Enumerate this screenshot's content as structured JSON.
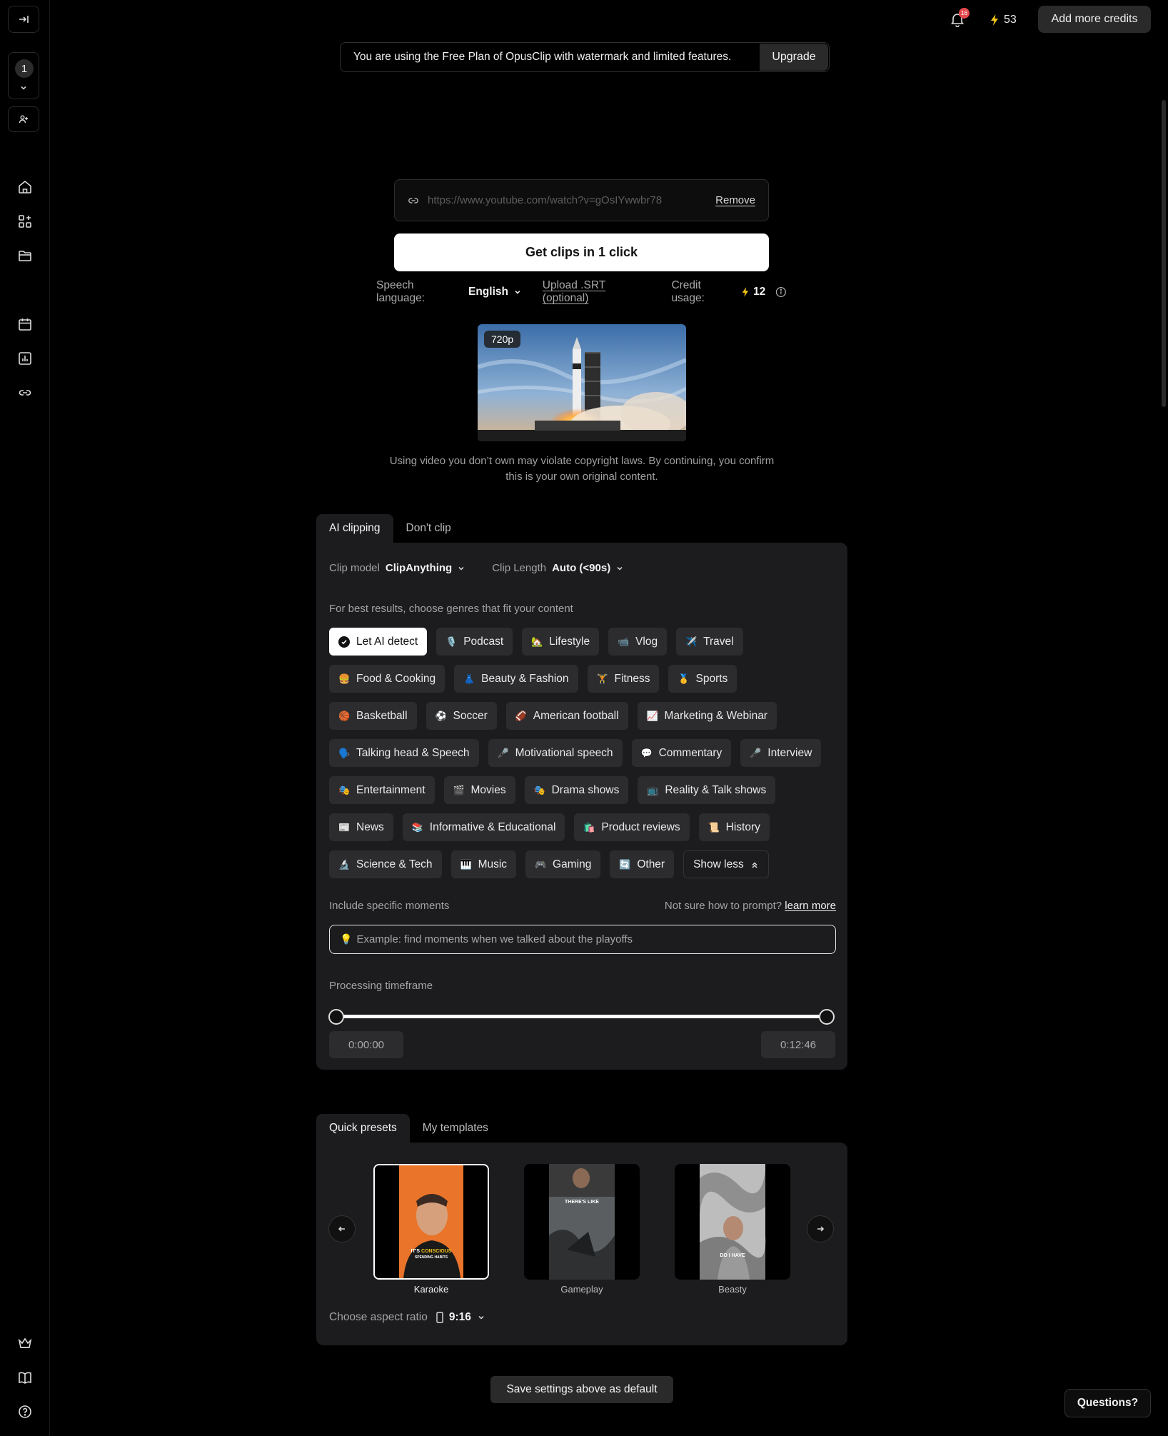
{
  "sidebar": {
    "workspace_number": "1"
  },
  "topbar": {
    "notification_count": "16",
    "credits_count": "53",
    "add_credits_label": "Add more credits"
  },
  "banner": {
    "text": "You are using the Free Plan of OpusClip with watermark and limited features.",
    "upgrade_label": "Upgrade"
  },
  "url_input": {
    "value": "https://www.youtube.com/watch?v=gOsIYwwbr78",
    "remove_label": "Remove"
  },
  "cta_label": "Get clips in 1 click",
  "options": {
    "speech_language_label": "Speech language:",
    "speech_language_value": "English",
    "upload_srt_label": "Upload .SRT (optional)",
    "credit_usage_label": "Credit usage:",
    "credit_usage_value": "12"
  },
  "video": {
    "resolution": "720p"
  },
  "disclaimer": {
    "line1": "Using video you don’t own may violate copyright laws. By continuing, you confirm",
    "line2": "this is your own original content."
  },
  "clipping_tabs": [
    "AI clipping",
    "Don't clip"
  ],
  "clip_settings": {
    "model_label": "Clip model",
    "model_value": "ClipAnything",
    "length_label": "Clip Length",
    "length_value": "Auto (<90s)",
    "genre_hint": "For best results, choose genres that fit your content"
  },
  "genre_rows": [
    [
      {
        "label": "Let AI detect",
        "emoji": "",
        "selected": true
      },
      {
        "label": "Podcast",
        "emoji": "🎙️"
      },
      {
        "label": "Lifestyle",
        "emoji": "🏡"
      },
      {
        "label": "Vlog",
        "emoji": "📹"
      },
      {
        "label": "Travel",
        "emoji": "✈️"
      }
    ],
    [
      {
        "label": "Food & Cooking",
        "emoji": "🍔"
      },
      {
        "label": "Beauty & Fashion",
        "emoji": "👗"
      },
      {
        "label": "Fitness",
        "emoji": "🏋️"
      },
      {
        "label": "Sports",
        "emoji": "🥇"
      }
    ],
    [
      {
        "label": "Basketball",
        "emoji": "🏀"
      },
      {
        "label": "Soccer",
        "emoji": "⚽"
      },
      {
        "label": "American football",
        "emoji": "🏈"
      },
      {
        "label": "Marketing & Webinar",
        "emoji": "📈"
      }
    ],
    [
      {
        "label": "Talking head & Speech",
        "emoji": "🗣️"
      },
      {
        "label": "Motivational speech",
        "emoji": "🎤"
      },
      {
        "label": "Commentary",
        "emoji": "💬"
      },
      {
        "label": "Interview",
        "emoji": "🎤"
      }
    ],
    [
      {
        "label": "Entertainment",
        "emoji": "🎭"
      },
      {
        "label": "Movies",
        "emoji": "🎬"
      },
      {
        "label": "Drama shows",
        "emoji": "🎭"
      },
      {
        "label": "Reality & Talk shows",
        "emoji": "📺"
      }
    ],
    [
      {
        "label": "News",
        "emoji": "📰"
      },
      {
        "label": "Informative & Educational",
        "emoji": "📚"
      },
      {
        "label": "Product reviews",
        "emoji": "🛍️"
      },
      {
        "label": "History",
        "emoji": "📜"
      }
    ],
    [
      {
        "label": "Science & Tech",
        "emoji": "🔬"
      },
      {
        "label": "Music",
        "emoji": "🎹"
      },
      {
        "label": "Gaming",
        "emoji": "🎮"
      },
      {
        "label": "Other",
        "emoji": "🔄"
      }
    ]
  ],
  "show_less_label": "Show less",
  "moments": {
    "label": "Include specific moments",
    "help_text": "Not sure how to prompt?",
    "help_link": "learn more",
    "placeholder": "Example: find moments when we talked about the playoffs"
  },
  "timeframe": {
    "label": "Processing timeframe",
    "start": "0:00:00",
    "end": "0:12:46"
  },
  "preset_tabs": [
    "Quick presets",
    "My templates"
  ],
  "presets": [
    {
      "name": "Karaoke",
      "caption": "IT'S CONSCIOUS SPENDING HABITS",
      "selected": true
    },
    {
      "name": "Gameplay",
      "caption": "THERE'S LIKE"
    },
    {
      "name": "Beasty",
      "caption": "DO I HAVE"
    }
  ],
  "aspect": {
    "label": "Choose aspect ratio",
    "value": "9:16"
  },
  "save_default_label": "Save settings above as default",
  "questions_label": "Questions?"
}
